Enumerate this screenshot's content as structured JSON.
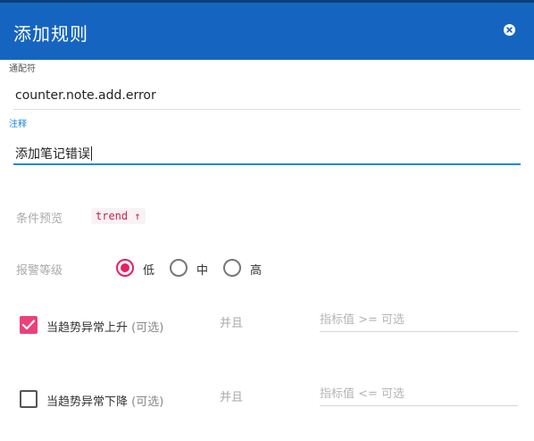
{
  "dialog": {
    "title": "添加规则"
  },
  "wildcard": {
    "label": "通配符",
    "value": "counter.note.add.error"
  },
  "note": {
    "label": "注释",
    "value": "添加笔记错误"
  },
  "condition_preview": {
    "label": "条件预览",
    "chip": "trend ↑"
  },
  "alert_level": {
    "label": "报警等级",
    "options": [
      "低",
      "中",
      "高"
    ],
    "selected": "低"
  },
  "trend_up": {
    "label": "当趋势异常上升",
    "optional": "(可选)",
    "checked": true,
    "and_label": "并且",
    "placeholder": "指标值 >= 可选"
  },
  "trend_down": {
    "label": "当趋势异常下降",
    "optional": "(可选)",
    "checked": false,
    "and_label": "并且",
    "placeholder": "指标值 <= 可选"
  },
  "colors": {
    "header": "#1565c0",
    "accent": "#1e88e5",
    "checked": "#e91e63",
    "chip_text": "#c7254e"
  },
  "icons": {
    "close": "close-circle-icon",
    "check": "check-icon"
  }
}
